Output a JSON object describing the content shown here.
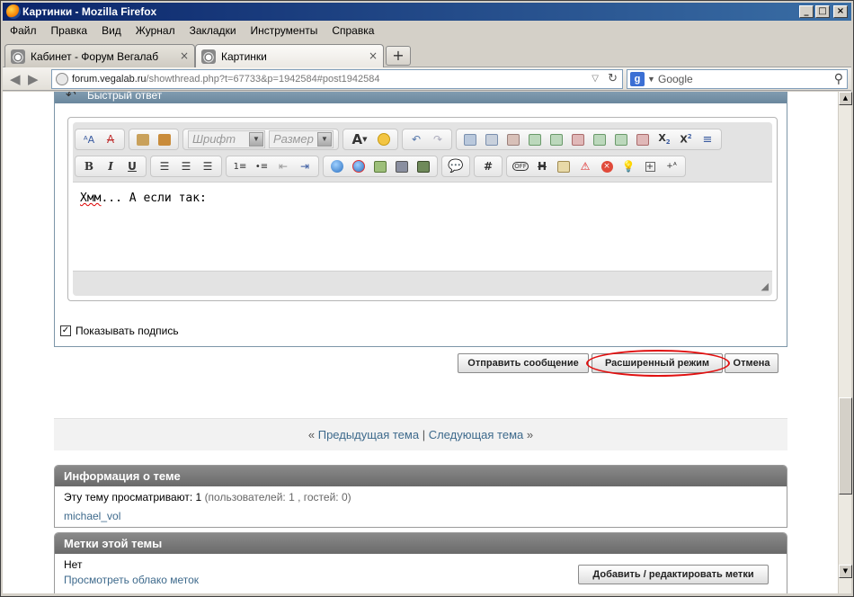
{
  "window": {
    "title": "Картинки - Mozilla Firefox"
  },
  "menu": [
    "Файл",
    "Правка",
    "Вид",
    "Журнал",
    "Закладки",
    "Инструменты",
    "Справка"
  ],
  "tabs": [
    {
      "label": "Кабинет - Форум Вегалаб",
      "active": false
    },
    {
      "label": "Картинки",
      "active": true
    }
  ],
  "nav": {
    "url_domain": "forum.vegalab.ru",
    "url_path": "/showthread.php?t=67733&p=1942584#post1942584",
    "search_placeholder": "Google"
  },
  "quick_reply": {
    "heading": "Быстрый ответ",
    "font_select": "Шрифт",
    "size_select": "Размер",
    "text_word": "Хмм",
    "text_rest": "... А если так:",
    "show_signature": "Показывать подпись",
    "submit_label": "Отправить сообщение",
    "advanced_label": "Расширенный режим",
    "cancel_label": "Отмена",
    "highlight_color": "#e01010"
  },
  "thread_nav": {
    "prev_prefix": "«",
    "prev_label": "Предыдущая тема",
    "separator": "|",
    "next_label": "Следующая тема",
    "next_suffix": "»"
  },
  "thread_info": {
    "heading": "Информация о теме",
    "viewing_label": "Эту тему просматривают: 1",
    "viewing_detail": "(пользователей: 1 , гостей: 0)",
    "user": "michael_vol"
  },
  "tags": {
    "heading": "Метки этой темы",
    "none_label": "Нет",
    "cloud_link": "Просмотреть облако меток",
    "edit_button": "Добавить / редактировать метки"
  }
}
